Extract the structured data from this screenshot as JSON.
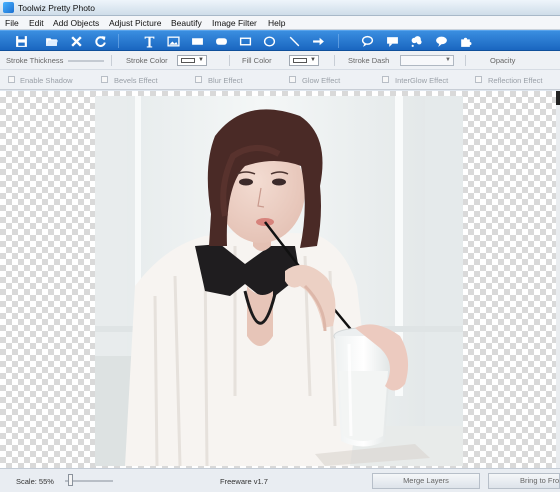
{
  "window": {
    "title": "Toolwiz Pretty Photo"
  },
  "menu": [
    "File",
    "Edit",
    "Add Objects",
    "Adjust Picture",
    "Beautify",
    "Image Filter",
    "Help"
  ],
  "toolbar": {
    "icons": [
      "save-icon",
      "open-folder-icon",
      "close-icon",
      "refresh-icon",
      "text-tool-icon",
      "image-tool-icon",
      "rectangle-filled-icon",
      "rounded-rectangle-filled-icon",
      "rectangle-outline-icon",
      "ellipse-outline-icon",
      "line-tool-icon",
      "arrow-tool-icon",
      "speech-bubble-round-icon",
      "speech-bubble-rect-icon",
      "thought-cloud-icon",
      "speech-cloud-icon",
      "puzzle-shape-icon"
    ]
  },
  "properties": {
    "stroke_thickness": "Stroke Thickness",
    "stroke_color": "Stroke Color",
    "fill_color": "Fill Color",
    "stroke_dash": "Stroke Dash",
    "opacity": "Opacity"
  },
  "effects": [
    "Enable Shadow",
    "Bevels Effect",
    "Blur Effect",
    "Glow Effect",
    "InterGlow Effect",
    "Reflection Effect"
  ],
  "status": {
    "scale": "Scale: 55%",
    "edition": "Freeware v1.7",
    "merge_layers": "Merge Layers",
    "bring_to_front": "Bring to Front"
  },
  "colors": {
    "toolbar": "#1f6fc8",
    "canvas_checker": "#d9d9d9"
  }
}
